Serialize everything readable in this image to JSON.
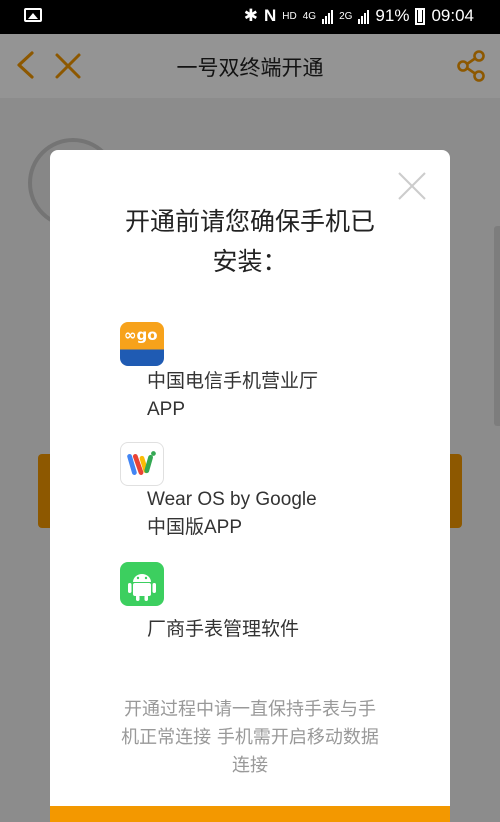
{
  "status_bar": {
    "network_hd": "HD",
    "network_4g": "4G",
    "network_2g": "2G",
    "battery": "91%",
    "time": "09:04"
  },
  "header": {
    "title": "一号双终端开通",
    "back_icon": "chevron-left-icon",
    "close_icon": "close-icon",
    "share_icon": "share-icon"
  },
  "dialog": {
    "heading_line1": "开通前请您确保手机已",
    "heading_line2": "安装：",
    "items": [
      {
        "icon": "china-telecom-app-icon",
        "icon_text": "∞go",
        "line1": "中国电信手机营业厅",
        "line2": "APP"
      },
      {
        "icon": "wear-os-icon",
        "line1": "Wear OS by Google",
        "line2": "中国版APP"
      },
      {
        "icon": "android-icon",
        "line1": "厂商手表管理软件",
        "line2": ""
      }
    ],
    "notice_line1": "开通过程中请一直保持手表与手",
    "notice_line2": "机正常连接 手机需开启移动数据",
    "notice_line3": "连接"
  },
  "colors": {
    "accent": "#f39800",
    "overlay": "#00000070",
    "android_green": "#3ccf5f"
  }
}
